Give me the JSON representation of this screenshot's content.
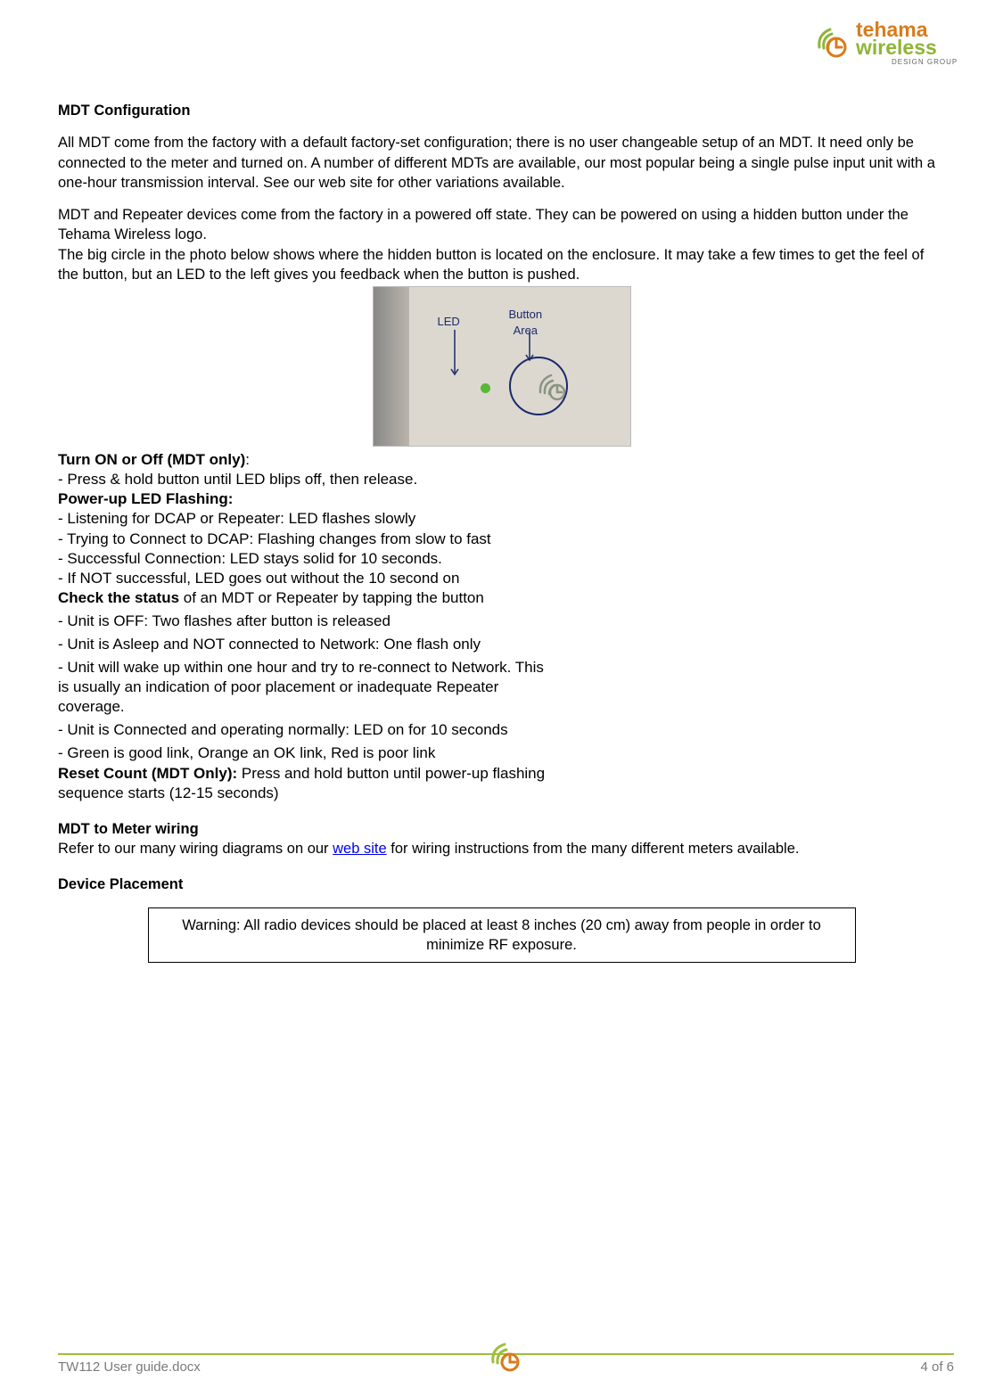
{
  "logo": {
    "name": "tehama",
    "sub": "wireless",
    "tag": "DESIGN GROUP"
  },
  "h1": "MDT Configuration",
  "p1": "All MDT come from the factory with a default factory-set configuration; there is no user changeable setup of an MDT.  It need only be connected to the meter and turned on.  A number of different MDTs are available, our most popular being a single pulse input unit with a one-hour transmission interval.  See our web site for other variations available.",
  "p2": "MDT and Repeater devices come from the factory in a powered off state.  They can be powered on using a hidden button under the Tehama Wireless logo.",
  "p3": "The big circle in the photo below shows where the hidden button is located on the enclosure.  It may take a few times to get the feel of the button, but an LED to the left gives you feedback when the button is pushed.",
  "photo": {
    "led": "LED",
    "button": "Button\nArea"
  },
  "turn_h": "Turn ON or Off (MDT only)",
  "turn_colon": ":",
  "turn1": "- Press & hold button until LED blips off, then release.",
  "pwr_h": "Power-up LED Flashing:",
  "pwr1": "- Listening for DCAP or Repeater: LED flashes slowly",
  "pwr2": "- Trying to Connect to DCAP: Flashing changes from slow to fast",
  "pwr3": "- Successful Connection: LED stays solid for 10 seconds.",
  "pwr4": "- If NOT successful, LED goes out without the 10 second on",
  "chk_h": "Check the status",
  "chk_rest": " of an MDT or Repeater by tapping the button",
  "st1": "- Unit is OFF: Two flashes after button is released",
  "st2": "- Unit is Asleep and NOT connected to Network: One flash only",
  "st3": "- Unit will wake up within one hour and try to re-connect to Network. This is usually an indication of poor placement or inadequate Repeater coverage.",
  "st4": "- Unit is Connected and operating normally: LED on for 10 seconds",
  "st5": "- Green is good link, Orange an OK link, Red is poor link",
  "rst_h": "Reset Count (MDT Only):",
  "rst_rest": " Press and hold button until power-up flashing sequence starts (12-15 seconds)",
  "h2": "MDT to Meter wiring",
  "wiring_pre": "Refer to our many wiring diagrams on our ",
  "wiring_link": "web site",
  "wiring_post": " for wiring instructions from the many different meters available.",
  "h3": "Device Placement",
  "warning": "Warning:  All radio devices should be placed at least 8 inches (20 cm) away from people in order to minimize RF exposure.",
  "footer_left": "TW112 User guide.docx",
  "footer_right": "4 of 6"
}
